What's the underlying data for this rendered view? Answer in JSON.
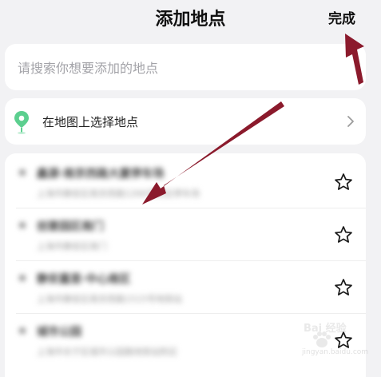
{
  "header": {
    "title": "添加地点",
    "done_label": "完成"
  },
  "search": {
    "placeholder": "请搜索你想要添加的地点",
    "value": ""
  },
  "map_pick": {
    "label": "在地图上选择地点",
    "pin_color": "#5ccf8f"
  },
  "recent_places": [
    {
      "title": "鑫源·南京西路大厦停车场",
      "subtitle": "上海市静安区南京西路1266号附近停车场"
    },
    {
      "title": "创意园区南门",
      "subtitle": "上海市静安区南门"
    },
    {
      "title": "静安嘉里·中心南区",
      "subtitle": "上海市静安区南京西路1515号地铁站"
    },
    {
      "title": "城市公园",
      "subtitle": "上海市长宁区城市公园路地铁站附近"
    }
  ],
  "watermark": {
    "brand": "Bai 经验",
    "url": "jingyan.baidu.com"
  },
  "annotation_color": "#8b1a2c"
}
